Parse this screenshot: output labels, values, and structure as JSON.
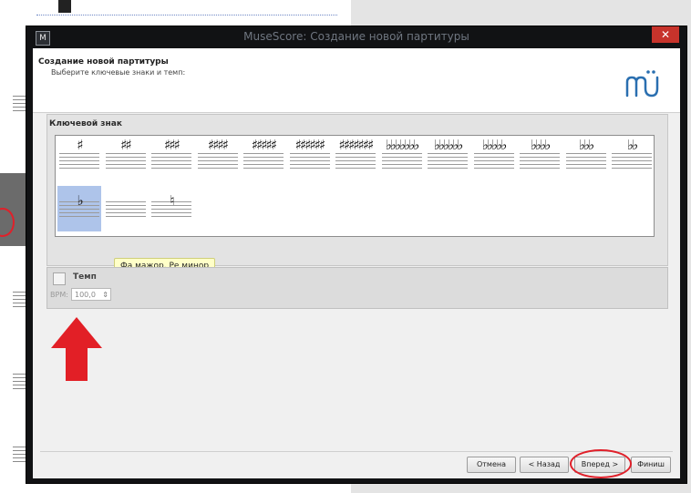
{
  "window": {
    "title": "MuseScore: Создание новой партитуры",
    "close_glyph": "✕",
    "app_icon": "M"
  },
  "header": {
    "title": "Создание новой партитуры",
    "subtitle": "Выберите ключевые знаки и темп:",
    "logo_icon": "musescore-logo-icon"
  },
  "key_signatures": {
    "group_label": "Ключевой знак",
    "items": [
      {
        "glyphs": "♯"
      },
      {
        "glyphs": "♯♯"
      },
      {
        "glyphs": "♯♯♯"
      },
      {
        "glyphs": "♯♯♯♯"
      },
      {
        "glyphs": "♯♯♯♯♯"
      },
      {
        "glyphs": "♯♯♯♯♯♯"
      },
      {
        "glyphs": "♯♯♯♯♯♯♯"
      },
      {
        "glyphs": "♭♭♭♭♭♭♭"
      },
      {
        "glyphs": "♭♭♭♭♭♭"
      },
      {
        "glyphs": "♭♭♭♭♭"
      },
      {
        "glyphs": "♭♭♭♭"
      },
      {
        "glyphs": "♭♭♭"
      },
      {
        "glyphs": "♭♭"
      },
      {
        "glyphs": "♭"
      },
      {
        "glyphs": ""
      },
      {
        "glyphs": "♮"
      }
    ],
    "selected_index": 13,
    "tooltip": "Фа мажор, Ре минор"
  },
  "tempo": {
    "checkbox_label": "Темп",
    "checked": false,
    "bpm_label": "BPM:",
    "bpm_value": "100,0"
  },
  "buttons": {
    "cancel": "Отмена",
    "back": "< Назад",
    "next": "Вперед >",
    "finish": "Финиш"
  },
  "colors": {
    "selection": "#aec4ea",
    "annotation_red": "#e0202a",
    "title_text": "#6f7680"
  }
}
